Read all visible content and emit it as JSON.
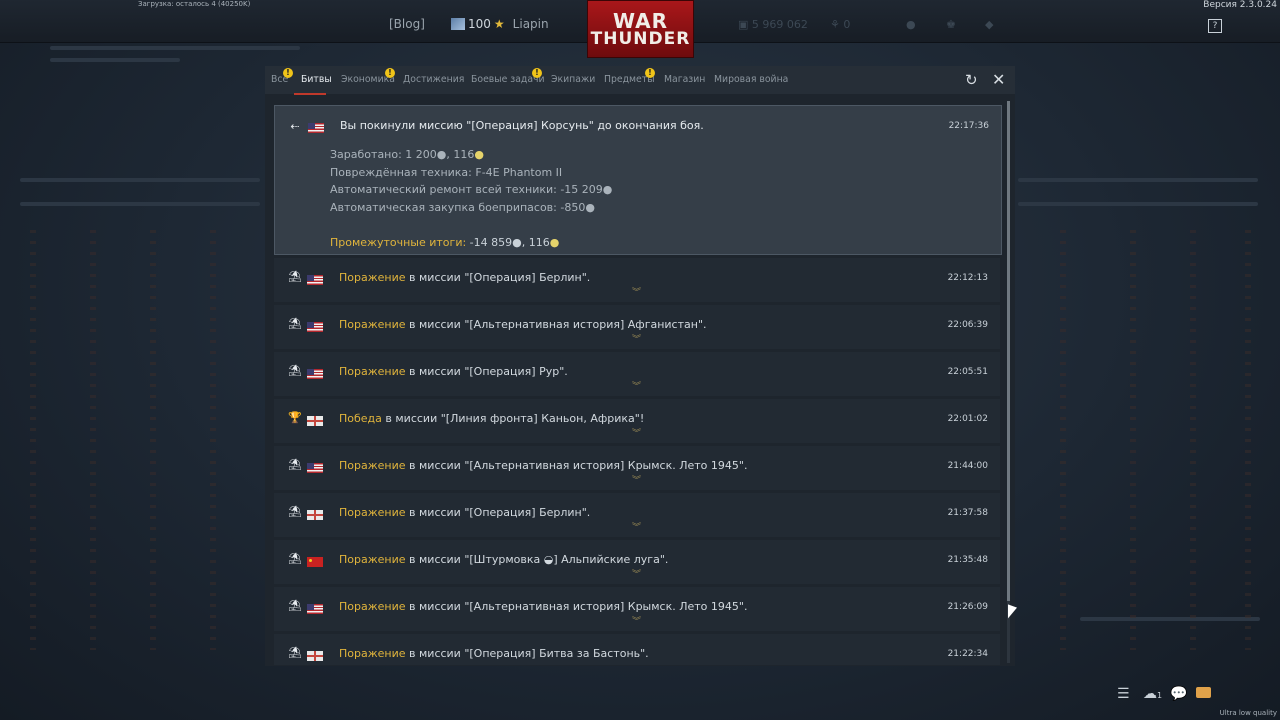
{
  "topbar": {
    "loading_text": "Загрузка: осталось 4 (40250K)",
    "version": "Версия 2.3.0.24",
    "blog": "[Blog]",
    "rank": "100",
    "player_name": "Liapin",
    "balance": "5 969 062",
    "premium": "0",
    "logo_line1": "WAR",
    "logo_line2": "THUNDER",
    "help_label": "?"
  },
  "tabs": [
    {
      "label": "Все",
      "warning": true
    },
    {
      "label": "Битвы",
      "warning": false,
      "active": true
    },
    {
      "label": "Экономика",
      "warning": true
    },
    {
      "label": "Достижения",
      "warning": false
    },
    {
      "label": "Боевые задачи",
      "warning": true
    },
    {
      "label": "Экипажи",
      "warning": false
    },
    {
      "label": "Предметы",
      "warning": true
    },
    {
      "label": "Магазин",
      "warning": false
    },
    {
      "label": "Мировая война",
      "warning": false
    }
  ],
  "expanded": {
    "message": "Вы покинули миссию \"[Операция] Корсунь\" до окончания боя.",
    "time": "22:17:36",
    "earned_label": "Заработано: 1 200",
    "earned_rp": ", 116",
    "damaged_label": "Повреждённая техника: F-4E Phantom II",
    "repair_label": "Автоматический ремонт всей техники: -15 209",
    "ammo_label": "Автоматическая закупка боеприпасов: -850",
    "total_label": "Промежуточные итоги: ",
    "total_value": "-14 859",
    "total_rp": ", 116"
  },
  "rows": [
    {
      "result": "Поражение",
      "text": " в миссии \"[Операция] Берлин\".",
      "time": "22:12:13",
      "nation": "us",
      "icon": "parachute"
    },
    {
      "result": "Поражение",
      "text": " в миссии \"[Альтернативная история] Афганистан\".",
      "time": "22:06:39",
      "nation": "us",
      "icon": "parachute"
    },
    {
      "result": "Поражение",
      "text": " в миссии \"[Операция] Рур\".",
      "time": "22:05:51",
      "nation": "us",
      "icon": "parachute"
    },
    {
      "result": "Победа",
      "text": " в миссии \"[Линия фронта] Каньон, Африка\"!",
      "time": "22:01:02",
      "nation": "de",
      "icon": "trophy"
    },
    {
      "result": "Поражение",
      "text": " в миссии \"[Альтернативная история] Крымск. Лето 1945\".",
      "time": "21:44:00",
      "nation": "us",
      "icon": "parachute"
    },
    {
      "result": "Поражение",
      "text": " в миссии \"[Операция] Берлин\".",
      "time": "21:37:58",
      "nation": "de",
      "icon": "parachute"
    },
    {
      "result": "Поражение",
      "text": " в миссии \"[Штурмовка ◒] Альпийские луга\".",
      "time": "21:35:48",
      "nation": "ussr",
      "icon": "parachute"
    },
    {
      "result": "Поражение",
      "text": " в миссии \"[Альтернативная история] Крымск. Лето 1945\".",
      "time": "21:26:09",
      "nation": "us",
      "icon": "parachute"
    },
    {
      "result": "Поражение",
      "text": " в миссии \"[Операция] Битва за Бастонь\".",
      "time": "21:22:34",
      "nation": "de",
      "icon": "parachute"
    }
  ],
  "footer": {
    "quality": "Ultra low quality",
    "squad_count": "1"
  },
  "icons": {
    "silver_lions": "silver-lions-icon",
    "research_points": "research-points-icon",
    "parachute": "parachute-icon",
    "trophy": "trophy-icon",
    "left_mission": "left-mission-icon"
  },
  "colors": {
    "accent_red": "#c0392b",
    "result_yellow": "#e0b43c",
    "warning": "#f0c419",
    "mail": "#e0a24a"
  }
}
